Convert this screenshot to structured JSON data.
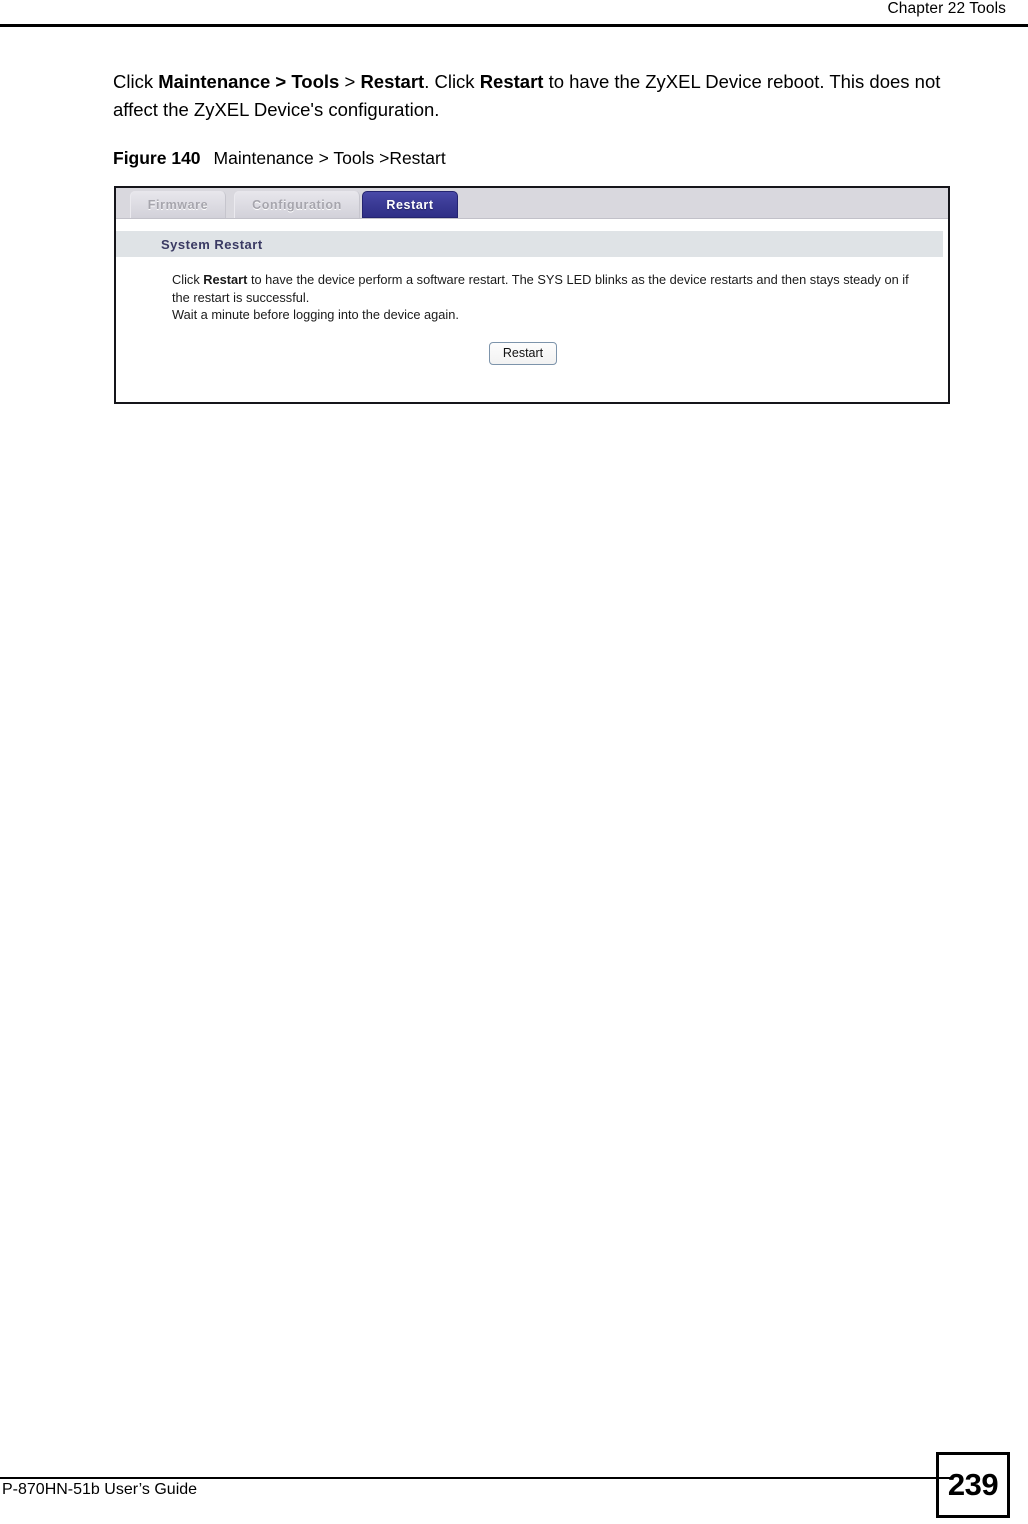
{
  "header": {
    "chapter_title": "Chapter 22 Tools"
  },
  "body": {
    "paragraph": {
      "part1": "Click ",
      "bold1": "Maintenance > Tools",
      "part2": " > ",
      "bold2": "Restart",
      "part3": ". Click ",
      "bold3": "Restart",
      "part4": " to have the ZyXEL Device reboot. This does not affect the ZyXEL Device's configuration."
    }
  },
  "figure": {
    "label": "Figure 140",
    "title": "Maintenance > Tools >Restart",
    "screenshot": {
      "tabs": [
        {
          "label": "Firmware",
          "active": false
        },
        {
          "label": "Configuration",
          "active": false
        },
        {
          "label": "Restart",
          "active": true
        }
      ],
      "section_title": "System Restart",
      "description": {
        "line1_part1": "Click ",
        "line1_bold": "Restart",
        "line1_part2": " to have the device perform a software restart. The SYS LED blinks as the device restarts and then stays steady on if the restart is successful.",
        "line2": "Wait a minute before logging into the device again."
      },
      "restart_button_label": "Restart",
      "colors": {
        "active_tab": "#3b3b96",
        "inactive_tab": "#dcdbe2",
        "tab_strip": "#d9d8de",
        "section_band": "#dfe3e6",
        "section_title_text": "#3a3a63",
        "button_border": "#7d94ab"
      }
    }
  },
  "footer": {
    "guide_title": "P-870HN-51b User’s Guide",
    "page_number": "239"
  }
}
